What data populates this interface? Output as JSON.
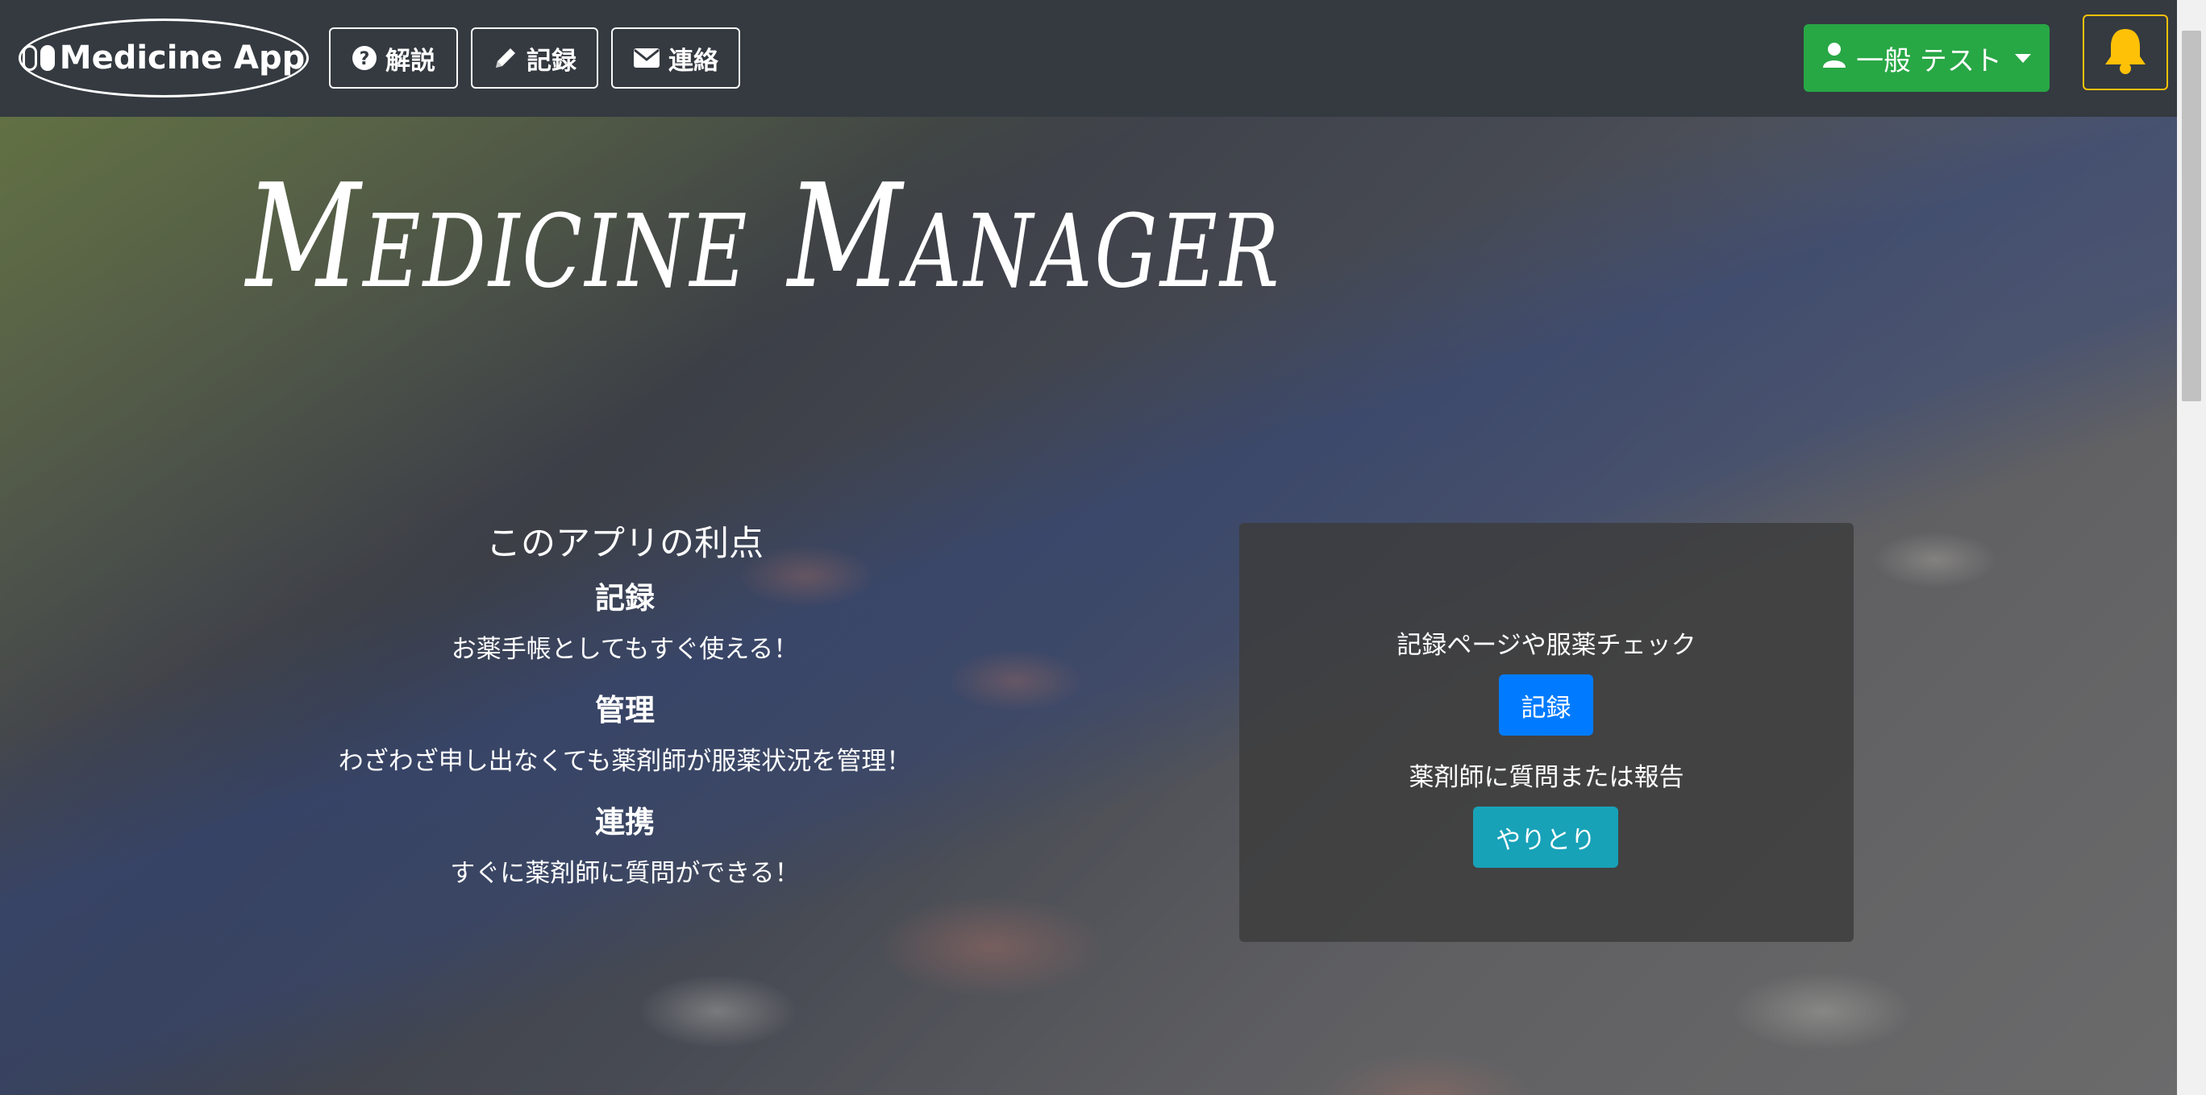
{
  "navbar": {
    "brand": "Medicine App",
    "brand_icon": "pills-icon",
    "links": [
      {
        "label": "解説",
        "icon": "question-circle-icon"
      },
      {
        "label": "記録",
        "icon": "pencil-icon"
      },
      {
        "label": "連絡",
        "icon": "envelope-icon"
      }
    ],
    "user_menu": {
      "label": "一般 テスト",
      "icon": "user-icon"
    },
    "notifications_icon": "bell-icon"
  },
  "hero": {
    "title": "Medicine Manager",
    "benefits": {
      "heading": "このアプリの利点",
      "items": [
        {
          "title": "記録",
          "text": "お薬手帳としてもすぐ使える！"
        },
        {
          "title": "管理",
          "text": "わざわざ申し出なくても薬剤師が服薬状況を管理！"
        },
        {
          "title": "連携",
          "text": "すぐに薬剤師に質問ができる！"
        }
      ]
    },
    "panel": {
      "caption_record": "記録ページや服薬チェック",
      "record_button": "記録",
      "caption_chat": "薬剤師に質問または報告",
      "chat_button": "やりとり"
    }
  },
  "colors": {
    "navbar_bg": "#343a40",
    "user_button": "#28a745",
    "bell": "#ffc107",
    "record_button": "#007bff",
    "chat_button": "#17a2b8"
  }
}
